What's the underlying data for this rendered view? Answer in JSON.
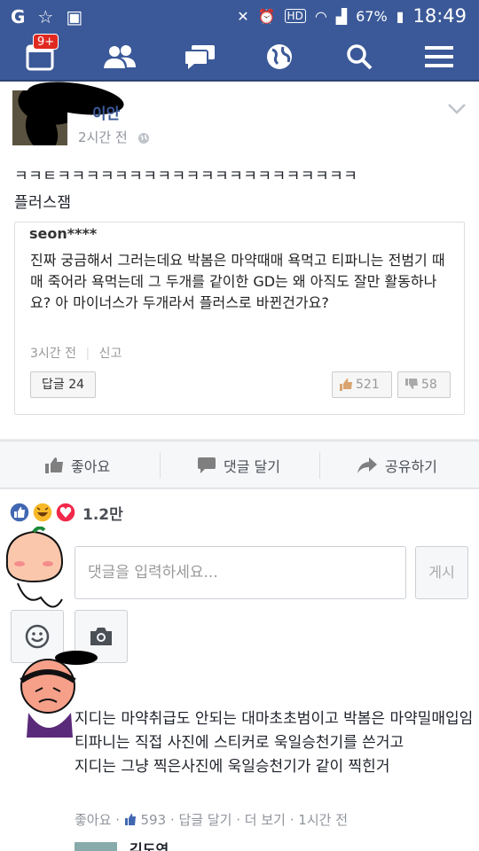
{
  "status_bar": {
    "battery": "67%",
    "time": "18:49",
    "hd_label": "HD"
  },
  "nav": {
    "notification_badge": "9+"
  },
  "post": {
    "author": "이안",
    "time": "2시간 전",
    "text_line1": "ㅋㅋㅌㅋㅋㅋㅋㅋㅋㅋㅋㅋㅋㅋㅋㅋㅋㅋㅋㅋㅋㅋㅋㅋ",
    "text_line2": "플러스잼",
    "card": {
      "username": "seon****",
      "body": "진짜 궁금해서 그러는데요 박봄은 마약때매 욕먹고 티파니는 전범기 때매 죽어라 욕먹는데 그 두개를 같이한 GD는 왜 아직도 잘만 활동하나요? 아 마이너스가 두개라서 플러스로 바뀐건가요?",
      "time": "3시간 전",
      "report": "신고",
      "reply_label": "답글",
      "reply_count": "24",
      "likes": "521",
      "dislikes": "58"
    }
  },
  "actions": {
    "like": "좋아요",
    "comment": "댓글 달기",
    "share": "공유하기"
  },
  "reactions": {
    "count": "1.2만"
  },
  "composer": {
    "placeholder": "댓글을 입력하세요...",
    "post_button": "게시"
  },
  "comment": {
    "text_line1": "지디는 마약취급도 안되는 대마초초범이고 박봄은 마약밀매입임",
    "text_line2": "티파니는 직접 사진에 스티커로 욱일승천기를 쓴거고",
    "text_line3": "지디는 그냥 찍은사진에 욱일승천기가 같이 찍힌거",
    "like_label": "좋아요",
    "like_count": "593",
    "reply_label": "답글 달기",
    "more_label": "더 보기",
    "time": "1시간 전"
  },
  "next_comment": {
    "author": "김도연"
  },
  "colors": {
    "brand": "#3b5998",
    "badge": "#e02a20",
    "like_blue": "#4267b2",
    "love_red": "#f0284a",
    "haha_yellow": "#f7b928"
  },
  "icons": [
    "notifications-icon",
    "friends-icon",
    "messages-icon",
    "globe-icon",
    "search-icon",
    "menu-icon",
    "chevron-down-icon",
    "globe-privacy-icon",
    "thumbs-up-icon",
    "comment-icon",
    "share-icon",
    "like-reaction-icon",
    "haha-reaction-icon",
    "love-reaction-icon",
    "emoji-icon",
    "camera-icon"
  ]
}
